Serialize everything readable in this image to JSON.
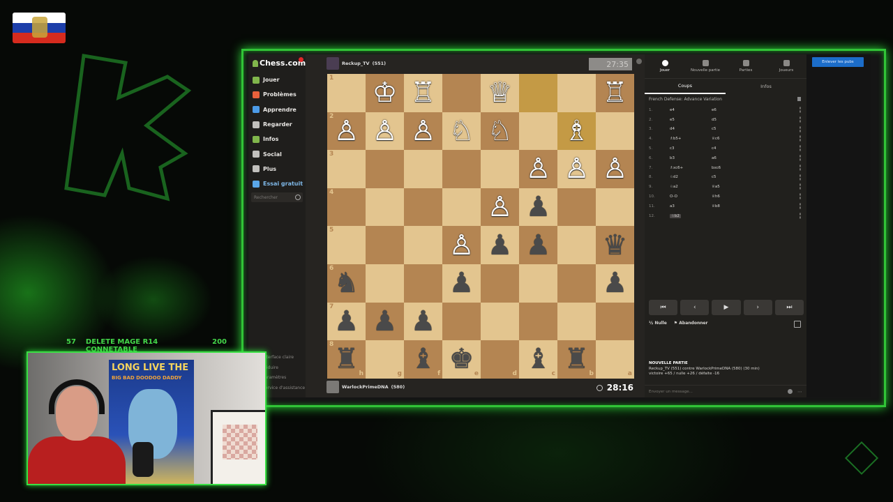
{
  "overlay": {
    "ticker": {
      "left": "57",
      "middle": "DELETE MAGE R14 CONNETABLE",
      "right": "200"
    }
  },
  "sidebar": {
    "brand": "Chess.com",
    "items": [
      {
        "label": "Jouer",
        "icon": "play-icon",
        "color": "#81b64c"
      },
      {
        "label": "Problèmes",
        "icon": "puzzle-icon",
        "color": "#e8613c"
      },
      {
        "label": "Apprendre",
        "icon": "learn-icon",
        "color": "#4c9be8"
      },
      {
        "label": "Regarder",
        "icon": "watch-icon",
        "color": "#c2c0bd"
      },
      {
        "label": "Infos",
        "icon": "news-icon",
        "color": "#81b64c"
      },
      {
        "label": "Social",
        "icon": "social-icon",
        "color": "#c2c0bd"
      },
      {
        "label": "Plus",
        "icon": "more-icon",
        "color": "#c2c0bd"
      },
      {
        "label": "Essai gratuit",
        "icon": "diamond-icon",
        "color": "#5aa6e8"
      }
    ],
    "search_placeholder": "Rechercher",
    "links": [
      "Interface claire",
      "Réduire",
      "Paramètres",
      "Service d'assistance"
    ]
  },
  "game": {
    "top_player": {
      "name": "Reckup_TV",
      "rating": "(551)"
    },
    "top_clock": "27:35",
    "bottom_player": {
      "name": "WarlockPrimeDNA",
      "rating": "(580)"
    },
    "bottom_clock": "28:16",
    "rank_labels": [
      "1",
      "2",
      "3",
      "4",
      "5",
      "6",
      "7",
      "8"
    ],
    "file_labels": [
      "h",
      "g",
      "f",
      "e",
      "d",
      "c",
      "b",
      "a"
    ]
  },
  "panel": {
    "tabs": [
      {
        "label": "Jouer",
        "icon": "clock-icon"
      },
      {
        "label": "Nouvelle partie",
        "icon": "plus-board-icon"
      },
      {
        "label": "Parties",
        "icon": "grid-icon"
      },
      {
        "label": "Joueurs",
        "icon": "users-icon"
      }
    ],
    "subtabs": [
      "Coups",
      "Infos"
    ],
    "opening": "French Defense: Advance Variation",
    "moves": [
      {
        "n": "1.",
        "w": "e4",
        "b": "e6"
      },
      {
        "n": "2.",
        "w": "e5",
        "b": "d5"
      },
      {
        "n": "3.",
        "w": "d4",
        "b": "c5"
      },
      {
        "n": "4.",
        "w": "♗b5+",
        "b": "♕c6"
      },
      {
        "n": "5.",
        "w": "c3",
        "b": "c4"
      },
      {
        "n": "6.",
        "w": "b3",
        "b": "a6"
      },
      {
        "n": "7.",
        "w": "♗xc6+",
        "b": "bxc6"
      },
      {
        "n": "8.",
        "w": "♘d2",
        "b": "c5"
      },
      {
        "n": "9.",
        "w": "♘a2",
        "b": "♕a5"
      },
      {
        "n": "10.",
        "w": "O-O",
        "b": "♕h6"
      },
      {
        "n": "11.",
        "w": "a3",
        "b": "♕b8"
      },
      {
        "n": "12.",
        "w": "♘b2",
        "b": ""
      }
    ],
    "actions": {
      "draw": "Nulle",
      "resign": "Abandonner"
    },
    "new_game": {
      "title": "NOUVELLE PARTIE",
      "line1": "Reckup_TV (551) contre WarlockPrimeDNA (580) (30 min)",
      "line2": "victoire +65 / nulle +26 / défaite -16"
    },
    "chat_placeholder": "Envoyer un message...",
    "cta": "Enlever les pubs"
  },
  "webcam": {
    "poster_line1": "LONG LIVE THE",
    "poster_line2": "BIG BAD DOODOO DADDY"
  }
}
